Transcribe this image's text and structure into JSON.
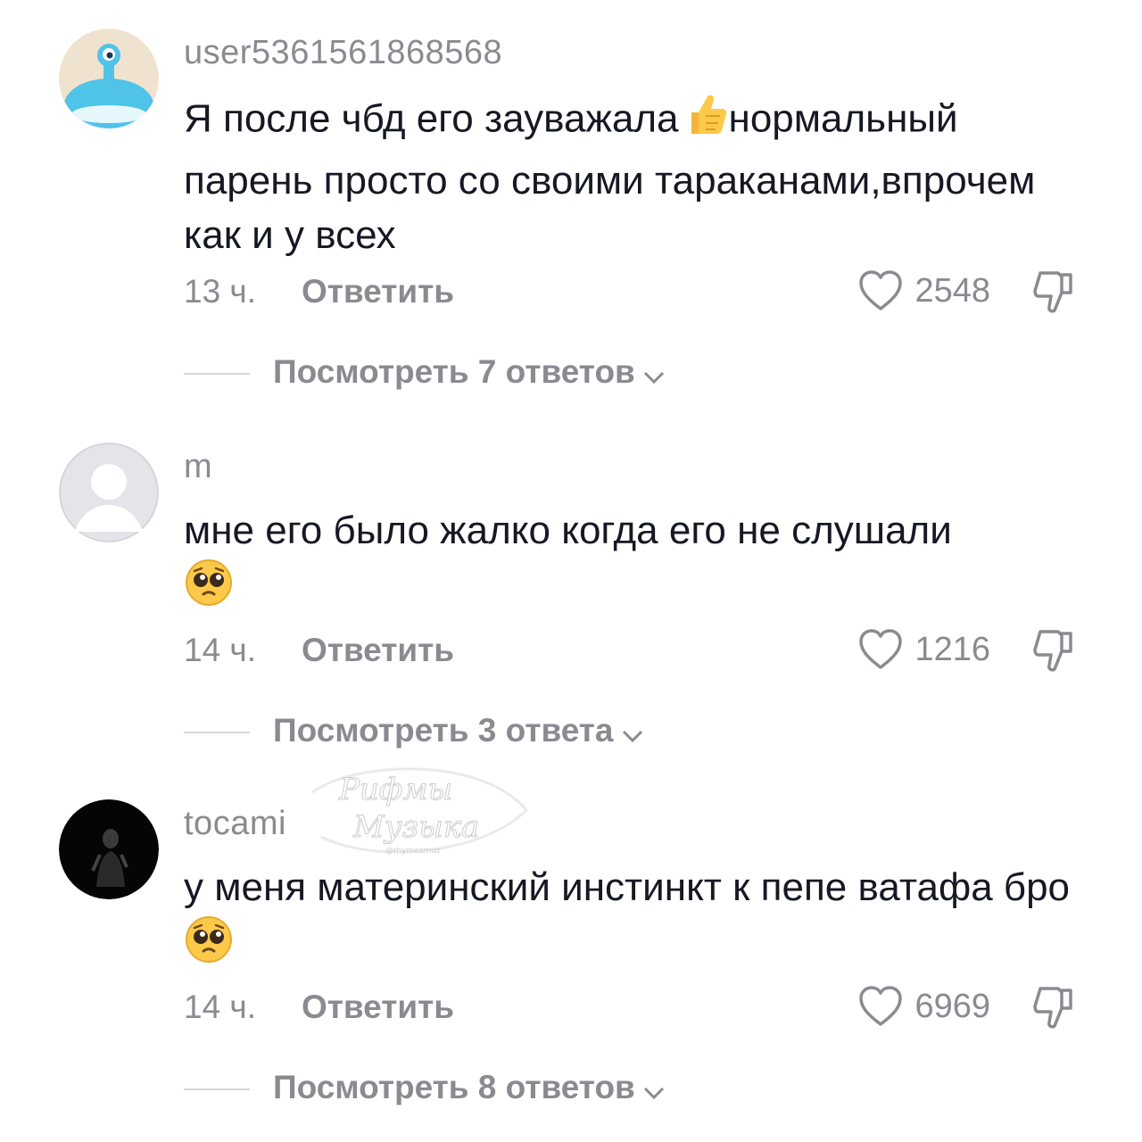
{
  "comments": [
    {
      "username": "user5361561868568",
      "text_before": "Я после чбд его зауважала",
      "emoji": "thumbs-up",
      "text_after": "нормальный парень просто со своими тараканами,впрочем как и у всех",
      "time": "13 ч.",
      "reply_label": "Ответить",
      "likes": "2548",
      "view_replies": "Посмотреть 7 ответов"
    },
    {
      "username": "m",
      "text_before": "мне его было жалко когда его не слушали",
      "emoji": "pleading-face",
      "text_after": "",
      "time": "14 ч.",
      "reply_label": "Ответить",
      "likes": "1216",
      "view_replies": "Посмотреть 3 ответа"
    },
    {
      "username": "tocami",
      "text_before": "у меня материнский инстинкт к пепе ватафа бро",
      "emoji": "pleading-face",
      "text_after": "",
      "time": "14 ч.",
      "reply_label": "Ответить",
      "likes": "6969",
      "view_replies": "Посмотреть 8 ответов"
    }
  ],
  "icons": {
    "like": "heart-outline-icon",
    "dislike": "thumbs-down-outline-icon",
    "expand": "chevron-down-icon"
  },
  "watermark": {
    "line1": "Рифмы",
    "line2": "Музыка",
    "handle": "@rhymesmuz"
  },
  "colors": {
    "text": "#161823",
    "secondary": "#8a8b91",
    "divider": "#d6d6d8"
  }
}
